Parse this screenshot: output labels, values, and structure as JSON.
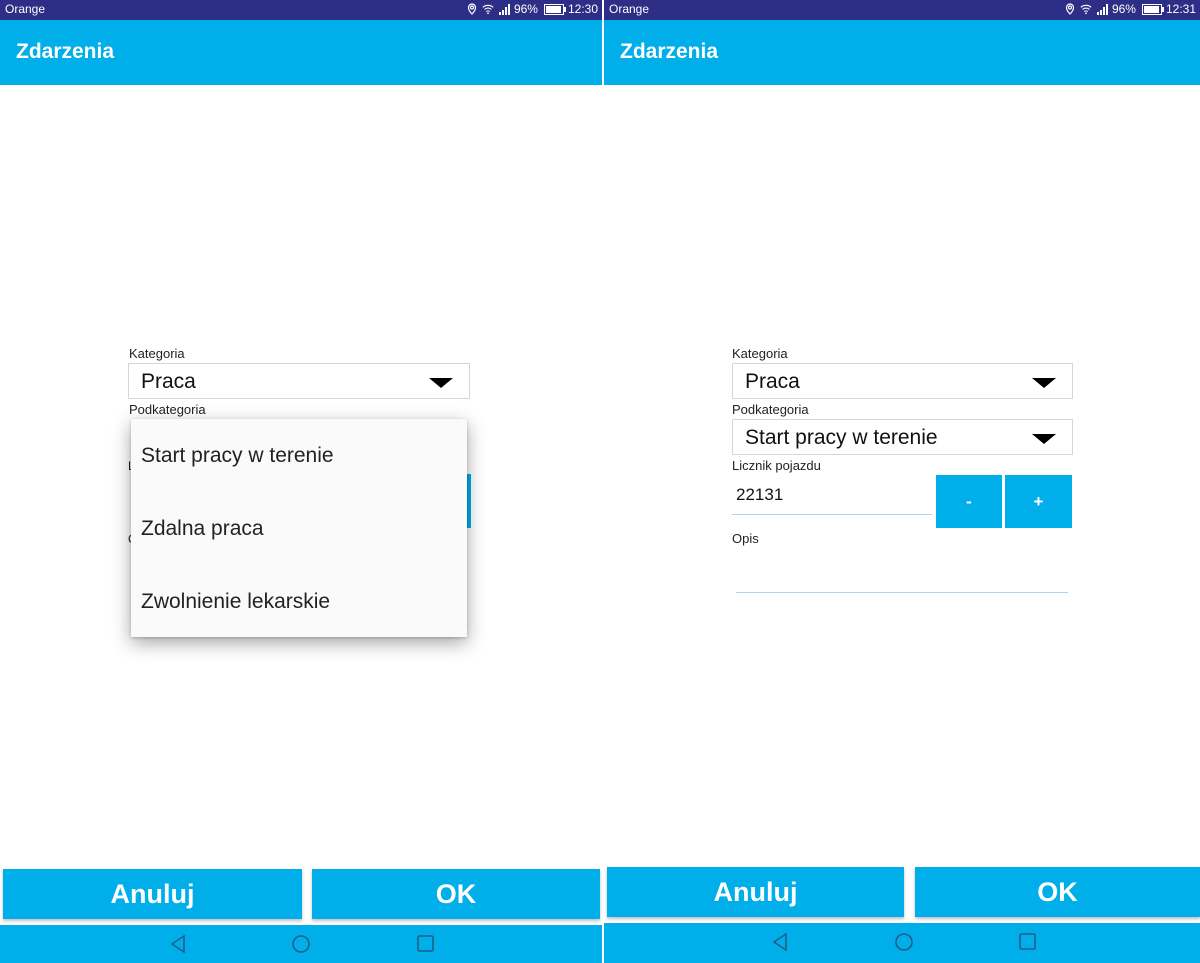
{
  "colors": {
    "accent": "#00aeea",
    "statusbar": "#2d2e86"
  },
  "screens": [
    {
      "status": {
        "carrier": "Orange",
        "battery": "96%",
        "battery_level": 0.96,
        "time": "12:30"
      },
      "title": "Zdarzenia",
      "kategoria_label": "Kategoria",
      "kategoria_value": "Praca",
      "podkategoria_label": "Podkategoria",
      "dropdown_options": [
        "Start pracy w terenie",
        "Zdalna praca",
        "Zwolnienie lekarskie"
      ],
      "cancel_label": "Anuluj",
      "ok_label": "OK"
    },
    {
      "status": {
        "carrier": "Orange",
        "battery": "96%",
        "battery_level": 0.96,
        "time": "12:31"
      },
      "title": "Zdarzenia",
      "kategoria_label": "Kategoria",
      "kategoria_value": "Praca",
      "podkategoria_label": "Podkategoria",
      "podkategoria_value": "Start pracy w terenie",
      "licznik_label": "Licznik pojazdu",
      "licznik_value": "22131",
      "minus_label": "-",
      "plus_label": "+",
      "opis_label": "Opis",
      "opis_value": "",
      "cancel_label": "Anuluj",
      "ok_label": "OK"
    }
  ],
  "icons": {
    "status": [
      "location-icon",
      "wifi-icon",
      "signal-icon",
      "battery-icon"
    ],
    "nav": [
      "back-icon",
      "home-icon",
      "recents-icon"
    ],
    "spinner": "dropdown-arrow-icon"
  }
}
